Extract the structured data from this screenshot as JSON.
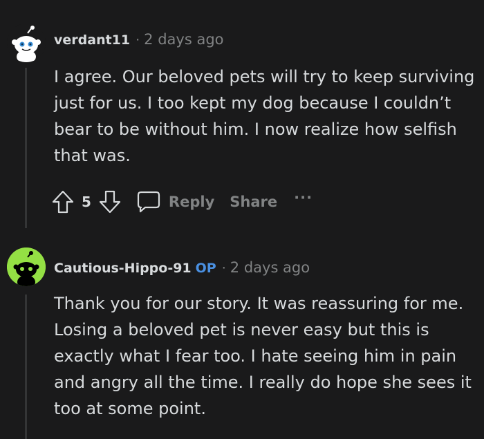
{
  "comments": [
    {
      "username": "verdant11",
      "op_badge": "",
      "separator": "·",
      "time": "2 days ago",
      "body": "I agree. Our beloved pets will try to keep surviving just for us. I too kept my dog because I couldn’t bear to be without him. I now realize how selfish that was.",
      "score": "5",
      "reply_label": "Reply",
      "share_label": "Share",
      "more_label": "···",
      "avatar_bg": "#1a1a1b"
    },
    {
      "username": "Cautious-Hippo-91",
      "op_badge": "OP",
      "separator": "·",
      "time": "2 days ago",
      "body": "Thank you for our story. It was reassuring for me. Losing a beloved pet is never easy but this is exactly what I fear too. I hate seeing him in pain and angry all the time. I really do hope she sees it too at some point.",
      "avatar_bg": "#94e044"
    }
  ],
  "colors": {
    "background": "#1a1a1b",
    "text": "#d7dadc",
    "muted": "#818384",
    "op": "#4a90e2",
    "thread_line": "#343536"
  }
}
